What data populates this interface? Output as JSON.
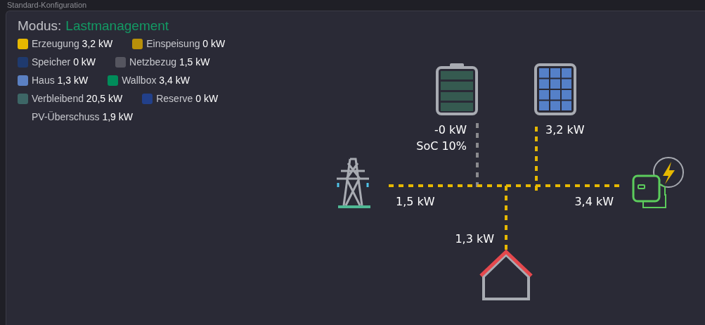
{
  "section_title": "Standard-Konfiguration",
  "mode": {
    "label": "Modus:",
    "value": "Lastmanagement"
  },
  "legend": [
    [
      {
        "label": "Erzeugung",
        "value": "3,2 kW",
        "color": "#e6b800"
      },
      {
        "label": "Einspeisung",
        "value": "0 kW",
        "color": "#b8900a"
      }
    ],
    [
      {
        "label": "Speicher",
        "value": "0 kW",
        "color": "#1f3a6e"
      },
      {
        "label": "Netzbezug",
        "value": "1,5 kW",
        "color": "#55555f"
      }
    ],
    [
      {
        "label": "Haus",
        "value": "1,3 kW",
        "color": "#5b80c2"
      },
      {
        "label": "Wallbox",
        "value": "3,4 kW",
        "color": "#008c5a"
      }
    ],
    [
      {
        "label": "Verbleibend",
        "value": "20,5 kW",
        "color": "#3d6666"
      },
      {
        "label": "Reserve",
        "value": "0 kW",
        "color": "#22408a"
      }
    ],
    [
      {
        "label": "PV-Überschuss",
        "value": "1,9 kW"
      }
    ]
  ],
  "flows": [
    {
      "kind": "battery",
      "active": false,
      "lines": [
        "-0 kW",
        "SoC 10%"
      ]
    },
    {
      "kind": "solar",
      "active": true,
      "lines": [
        "3,2 kW"
      ]
    },
    {
      "kind": "grid",
      "active": true,
      "lines": [
        "1,5 kW"
      ]
    },
    {
      "kind": "wallbox",
      "active": true,
      "lines": [
        "3,4 kW"
      ]
    },
    {
      "kind": "house",
      "active": true,
      "lines": [
        "1,3 kW"
      ]
    }
  ]
}
